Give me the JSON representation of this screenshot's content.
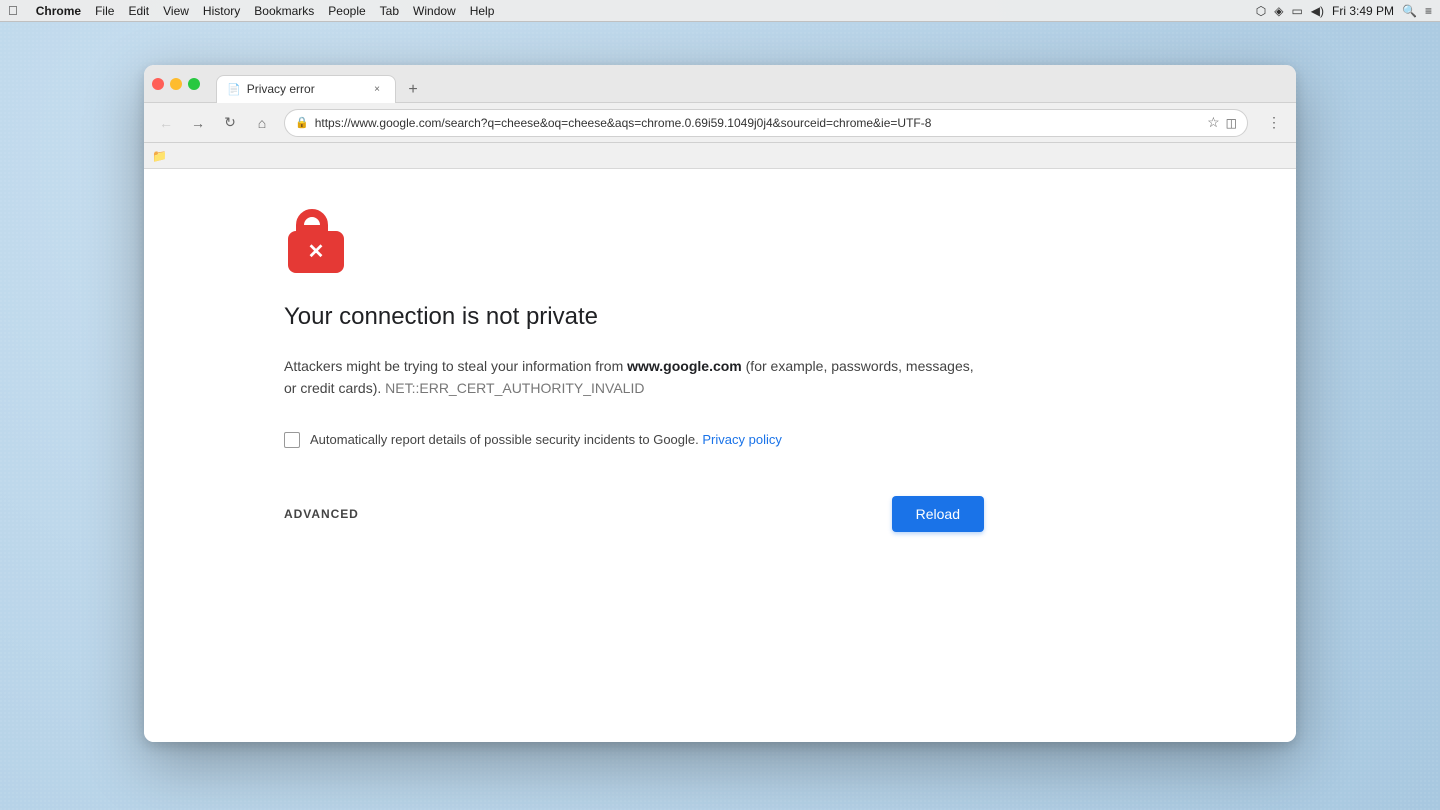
{
  "menubar": {
    "apple": "⌘",
    "items": [
      "Chrome",
      "File",
      "Edit",
      "View",
      "History",
      "Bookmarks",
      "People",
      "Tab",
      "Window",
      "Help"
    ],
    "time": "Fri 3:49 PM"
  },
  "browser": {
    "tab": {
      "title": "Privacy error",
      "close_label": "×"
    },
    "new_tab_label": "+",
    "nav": {
      "back_label": "←",
      "forward_label": "→",
      "reload_label": "↻",
      "home_label": "⌂",
      "url": "https://www.google.com/search?q=cheese&oq=cheese&aqs=chrome.0.69i59.1049j0j4&sourceid=chrome&ie=UTF-8",
      "star_label": "☆",
      "reader_label": "◫"
    }
  },
  "error_page": {
    "title": "Your connection is not private",
    "description_before": "Attackers might be trying to steal your information from ",
    "domain": "www.google.com",
    "description_after": " (for example, passwords, messages, or credit cards).",
    "error_code": "NET::ERR_CERT_AUTHORITY_INVALID",
    "checkbox_label": "Automatically report details of possible security incidents to Google.",
    "privacy_policy_label": "Privacy policy",
    "advanced_label": "ADVANCED",
    "reload_label": "Reload"
  }
}
